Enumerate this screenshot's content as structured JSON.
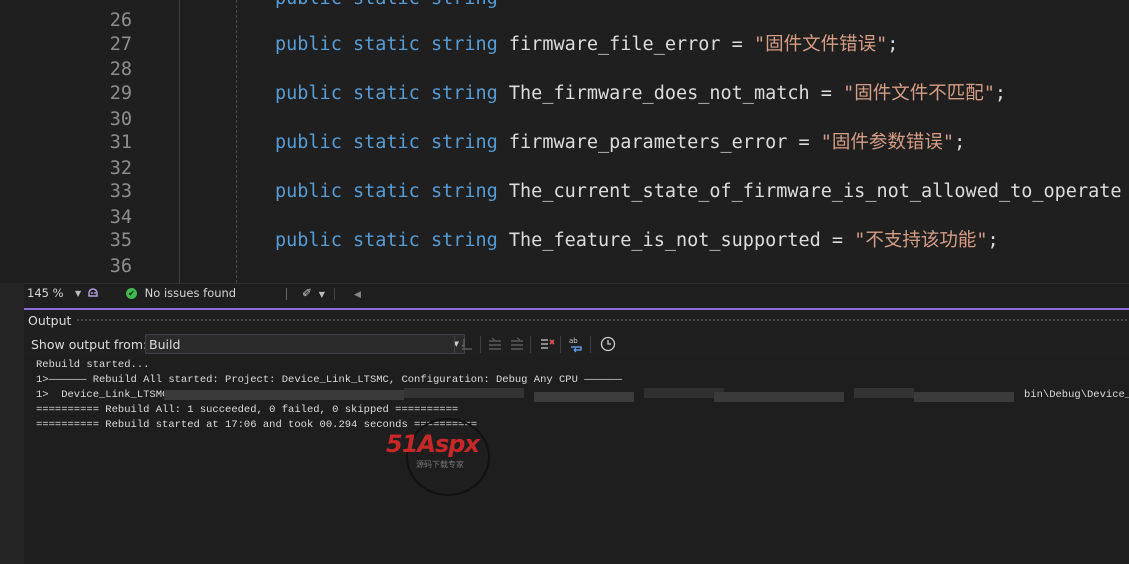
{
  "editor": {
    "lines": [
      {
        "num": "26",
        "ident": "",
        "value": ""
      },
      {
        "num": "27",
        "ident": "firmware_file_error",
        "value": "\"固件文件错误\""
      },
      {
        "num": "28",
        "ident": "",
        "value": ""
      },
      {
        "num": "29",
        "ident": "The_firmware_does_not_match",
        "value": "\"固件文件不匹配\""
      },
      {
        "num": "30",
        "ident": "",
        "value": ""
      },
      {
        "num": "31",
        "ident": "firmware_parameters_error",
        "value": "\"固件参数错误\""
      },
      {
        "num": "32",
        "ident": "",
        "value": ""
      },
      {
        "num": "33",
        "ident": "The_current_state_of_firmware_is_not_allowed_to_operate",
        "value": ""
      },
      {
        "num": "34",
        "ident": "",
        "value": ""
      },
      {
        "num": "35",
        "ident": "The_feature_is_not_supported",
        "value": "\"不支持该功能\""
      },
      {
        "num": "36",
        "ident": "",
        "value": ""
      }
    ],
    "kw_public": "public",
    "kw_static": "static",
    "kw_string": "string",
    "assign": " = ",
    "semicolon": ";",
    "truncated_tail": " ="
  },
  "status_bar": {
    "zoom": "145 %",
    "issues": "No issues found"
  },
  "output": {
    "title": "Output",
    "show_from_label": "Show output from:",
    "source": "Build",
    "lines": [
      "Rebuild started...",
      "1>—————— Rebuild All started: Project: Device_Link_LTSMC, Configuration: Debug Any CPU ——————",
      "1>  Device_Link_LTSMC",
      "========== Rebuild All: 1 succeeded, 0 failed, 0 skipped ==========",
      "========== Rebuild started at 17:06 and took 00.294 seconds =========="
    ],
    "line3_tail": "bin\\Debug\\Device_Li"
  },
  "watermark": {
    "brand": "51Aspx",
    "sub": "源码下载专家"
  },
  "colors": {
    "keyword": "#569cd6",
    "string": "#d69d85",
    "identifier": "#dcdcdc",
    "line_number": "#8e8e8e",
    "success": "#3fb950",
    "accent": "#8a6fd8"
  }
}
